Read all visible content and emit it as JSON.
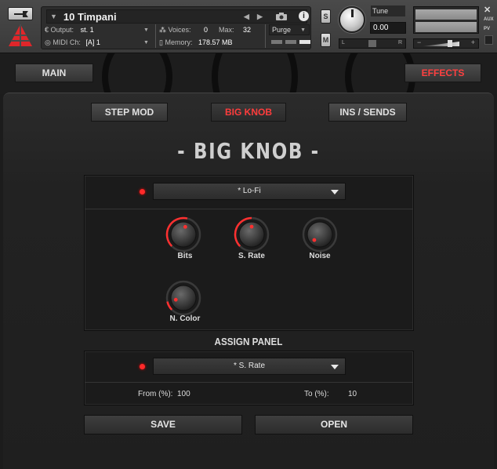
{
  "header": {
    "instrument_name": "10 Timpani",
    "output_label": "Output:",
    "output_value": "st. 1",
    "voices_label": "Voices:",
    "voices_value": "0",
    "max_label": "Max:",
    "max_value": "32",
    "purge_label": "Purge",
    "midi_label": "MIDI Ch:",
    "midi_value": "[A]  1",
    "memory_label": "Memory:",
    "memory_value": "178.57 MB",
    "solo_label": "S",
    "mute_label": "M",
    "tune_label": "Tune",
    "tune_value": "0.00",
    "pan_left": "L",
    "pan_right": "R",
    "vol_minus": "−",
    "vol_plus": "+",
    "close": "✕",
    "aux_label": "AUX",
    "pv_label": "PV"
  },
  "nav": {
    "main_label": "MAIN",
    "effects_label": "EFFECTS"
  },
  "tabs": [
    {
      "label": "STEP MOD"
    },
    {
      "label": "BIG KNOB"
    },
    {
      "label": "INS / SENDS"
    }
  ],
  "page_title": "- BIG KNOB -",
  "effect_panel": {
    "selected": "* Lo-Fi",
    "knobs": [
      {
        "label": "Bits",
        "value": 0.55
      },
      {
        "label": "S. Rate",
        "value": 0.5
      },
      {
        "label": "Noise",
        "value": 0.0
      },
      {
        "label": "N. Color",
        "value": 0.12
      }
    ]
  },
  "assign_panel": {
    "title": "ASSIGN PANEL",
    "selected": "* S. Rate",
    "from_label": "From (%):",
    "from_value": "100",
    "to_label": "To (%):",
    "to_value": "10"
  },
  "buttons": {
    "save_label": "SAVE",
    "open_label": "OPEN"
  },
  "colors": {
    "accent": "#ff3030",
    "panel": "#1b1b1b",
    "background": "#222222"
  }
}
